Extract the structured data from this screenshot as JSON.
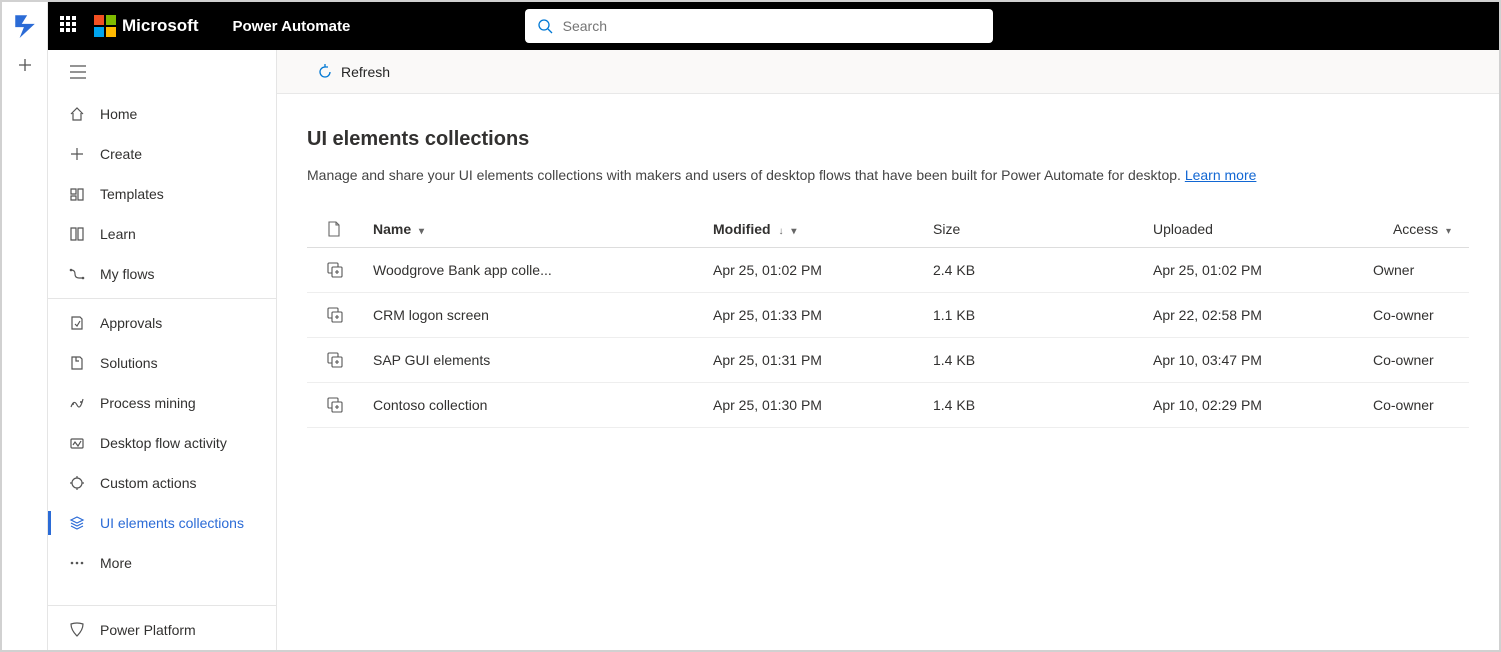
{
  "brand": {
    "microsoft": "Microsoft",
    "product": "Power Automate"
  },
  "search": {
    "placeholder": "Search"
  },
  "commandbar": {
    "refresh": "Refresh"
  },
  "sidebar": {
    "items": [
      {
        "label": "Home",
        "icon": "home-icon",
        "active": false
      },
      {
        "label": "Create",
        "icon": "plus-icon",
        "active": false
      },
      {
        "label": "Templates",
        "icon": "templates-icon",
        "active": false
      },
      {
        "label": "Learn",
        "icon": "book-icon",
        "active": false
      },
      {
        "label": "My flows",
        "icon": "flow-icon",
        "active": false
      }
    ],
    "items2": [
      {
        "label": "Approvals",
        "icon": "approval-icon",
        "active": false
      },
      {
        "label": "Solutions",
        "icon": "solutions-icon",
        "active": false
      },
      {
        "label": "Process mining",
        "icon": "process-icon",
        "active": false
      },
      {
        "label": "Desktop flow activity",
        "icon": "activity-icon",
        "active": false
      },
      {
        "label": "Custom actions",
        "icon": "custom-icon",
        "active": false
      },
      {
        "label": "UI elements collections",
        "icon": "layers-icon",
        "active": true
      },
      {
        "label": "More",
        "icon": "more-icon",
        "active": false
      }
    ],
    "footer": {
      "label": "Power Platform",
      "icon": "platform-icon"
    }
  },
  "page": {
    "title": "UI elements collections",
    "description": "Manage and share your UI elements collections with makers and users of desktop flows that have been built for Power Automate for desktop. ",
    "learn_more": "Learn more"
  },
  "table": {
    "columns": {
      "name": "Name",
      "modified": "Modified",
      "size": "Size",
      "uploaded": "Uploaded",
      "access": "Access"
    },
    "rows": [
      {
        "name": "Woodgrove Bank app colle...",
        "modified": "Apr 25, 01:02 PM",
        "size": "2.4 KB",
        "uploaded": "Apr 25, 01:02 PM",
        "access": "Owner"
      },
      {
        "name": "CRM logon screen",
        "modified": "Apr 25, 01:33 PM",
        "size": "1.1 KB",
        "uploaded": "Apr 22, 02:58 PM",
        "access": "Co-owner"
      },
      {
        "name": "SAP GUI elements",
        "modified": "Apr 25, 01:31 PM",
        "size": "1.4 KB",
        "uploaded": "Apr 10, 03:47 PM",
        "access": "Co-owner"
      },
      {
        "name": "Contoso collection",
        "modified": "Apr 25, 01:30 PM",
        "size": "1.4 KB",
        "uploaded": "Apr 10, 02:29 PM",
        "access": "Co-owner"
      }
    ]
  }
}
